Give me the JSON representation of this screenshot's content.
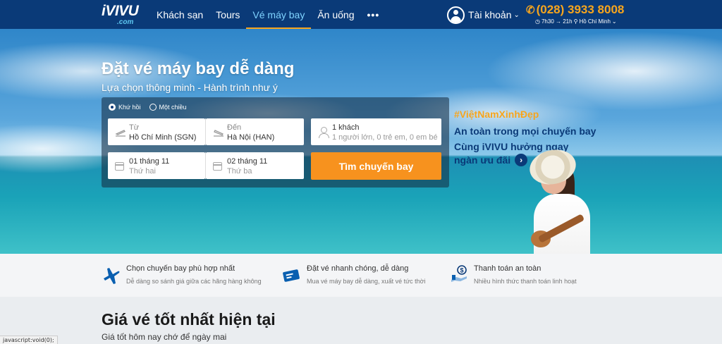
{
  "header": {
    "logo_main": "iVIVU",
    "logo_sub": ".com",
    "nav": [
      "Khách sạn",
      "Tours",
      "Vé máy bay",
      "Ăn uống"
    ],
    "nav_more": "•••",
    "account_label": "Tài khoản",
    "hotline": "(028) 3933 8008",
    "hours": "7h30 → 21h",
    "city": "Hồ Chí Minh"
  },
  "hero": {
    "title": "Đặt vé máy bay dễ dàng",
    "subtitle": "Lựa chọn thông minh - Hành trình như ý"
  },
  "search": {
    "trip_round": "Khứ hồi",
    "trip_oneway": "Một chiều",
    "from_label": "Từ",
    "from_value": "Hồ Chí Minh (SGN)",
    "to_label": "Đến",
    "to_value": "Hà Nội (HAN)",
    "pax_label": "1 khách",
    "pax_value": "1 người lớn, 0 trẻ em, 0 em bé",
    "depart_date": "01 tháng 11",
    "depart_day": "Thứ hai",
    "return_date": "02 tháng 11",
    "return_day": "Thứ ba",
    "button": "Tìm chuyến bay"
  },
  "promo": {
    "tag": "#ViệtNamXinhĐẹp",
    "line1": "An toàn trong mọi chuyến bay",
    "line2": "Cùng iVIVU hưởng ngay",
    "line3": "ngàn ưu đãi"
  },
  "features": [
    {
      "title": "Chọn chuyến bay phù hợp nhất",
      "desc": "Dễ dàng so sánh giá giữa các hãng hàng không",
      "icon": "plane-icon"
    },
    {
      "title": "Đặt vé nhanh chóng, dễ dàng",
      "desc": "Mua vé máy bay dễ dàng, xuất vé tức thời",
      "icon": "ticket-icon"
    },
    {
      "title": "Thanh toán an toàn",
      "desc": "Nhiều hình thức thanh toán linh hoạt",
      "icon": "payment-icon"
    }
  ],
  "best_price": {
    "title": "Giá vé tốt nhất hiện tại",
    "subtitle": "Giá tốt hôm nay chớ để ngày mai"
  },
  "statusbar": "javascript:void(0);",
  "colors": {
    "header_bg": "#0a3a78",
    "accent_orange": "#f7921e",
    "accent_yellow": "#f7a51d"
  }
}
